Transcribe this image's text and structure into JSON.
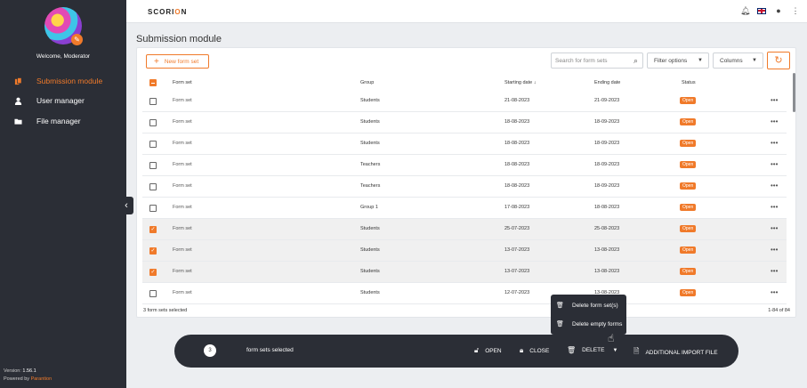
{
  "sidebar": {
    "welcome": "Welcome, Moderator",
    "items": [
      {
        "label": "Submission module",
        "icon": "documents-icon"
      },
      {
        "label": "User manager",
        "icon": "user-icon"
      },
      {
        "label": "File manager",
        "icon": "folder-icon"
      }
    ],
    "version_label": "Version:",
    "version": "1.56.1",
    "powered_label": "Powered by",
    "powered_brand": "Parantion"
  },
  "topbar": {
    "logo": "SCORI",
    "logo_accent": "O",
    "logo_end": "N"
  },
  "page": {
    "title": "Submission module"
  },
  "toolbar": {
    "new_label": "New form set",
    "search_placeholder": "Search for form sets",
    "filter_label": "Filter options",
    "columns_label": "Columns"
  },
  "table": {
    "headers": {
      "form_set": "Form set",
      "group": "Group",
      "start": "Starting date",
      "end": "Ending date",
      "status": "Status"
    },
    "rows": [
      {
        "name": "Form set",
        "group": "Students",
        "start": "21-08-2023",
        "end": "21-09-2023",
        "status": "Open",
        "checked": false
      },
      {
        "name": "Form set",
        "group": "Students",
        "start": "18-08-2023",
        "end": "18-09-2023",
        "status": "Open",
        "checked": false
      },
      {
        "name": "Form set",
        "group": "Students",
        "start": "18-08-2023",
        "end": "18-09-2023",
        "status": "Open",
        "checked": false
      },
      {
        "name": "Form set",
        "group": "Teachers",
        "start": "18-08-2023",
        "end": "18-09-2023",
        "status": "Open",
        "checked": false
      },
      {
        "name": "Form set",
        "group": "Teachers",
        "start": "18-08-2023",
        "end": "18-09-2023",
        "status": "Open",
        "checked": false
      },
      {
        "name": "Form set",
        "group": "Group 1",
        "start": "17-08-2023",
        "end": "18-08-2023",
        "status": "Open",
        "checked": false
      },
      {
        "name": "Form set",
        "group": "Students",
        "start": "25-07-2023",
        "end": "25-08-2023",
        "status": "Open",
        "checked": true
      },
      {
        "name": "Form set",
        "group": "Students",
        "start": "13-07-2023",
        "end": "13-08-2023",
        "status": "Open",
        "checked": true
      },
      {
        "name": "Form set",
        "group": "Students",
        "start": "13-07-2023",
        "end": "13-08-2023",
        "status": "Open",
        "checked": true
      },
      {
        "name": "Form set",
        "group": "Students",
        "start": "12-07-2023",
        "end": "13-08-2023",
        "status": "Open",
        "checked": false
      }
    ],
    "footer_selected": "3 form sets selected",
    "footer_range": "1-84 of 84"
  },
  "context_menu": {
    "items": [
      "Delete form set(s)",
      "Delete empty forms"
    ]
  },
  "action_bar": {
    "count": "3",
    "selected_text": "form sets selected",
    "open": "OPEN",
    "close": "CLOSE",
    "delete": "DELETE",
    "import": "ADDITIONAL IMPORT FILE"
  }
}
